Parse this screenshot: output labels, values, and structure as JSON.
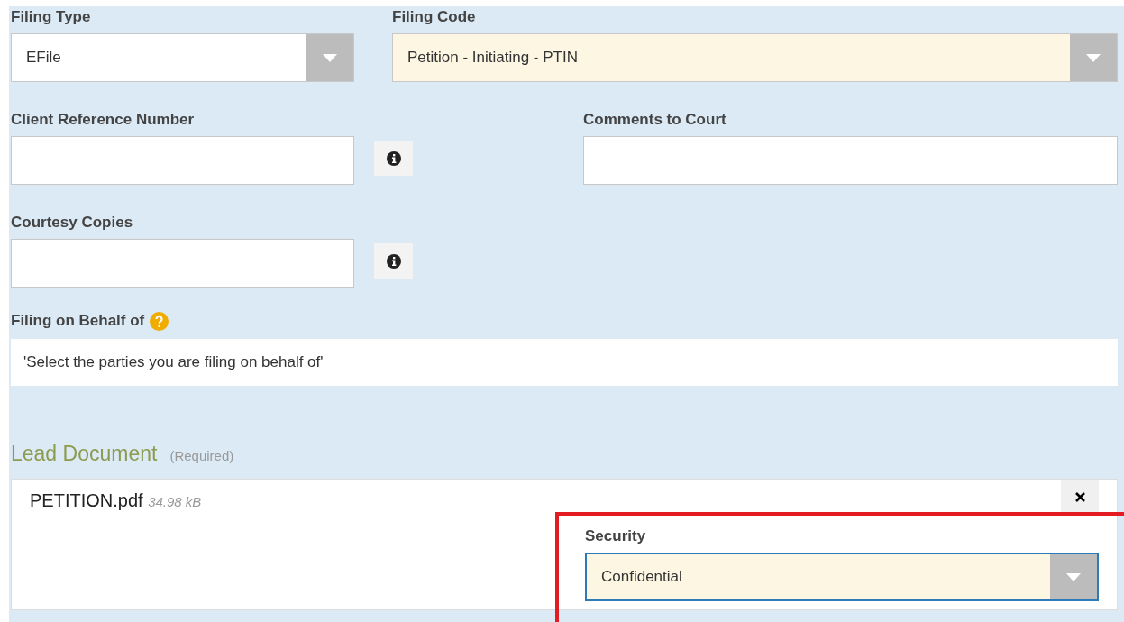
{
  "filing_type": {
    "label": "Filing Type",
    "value": "EFile",
    "highlighted": false
  },
  "filing_code": {
    "label": "Filing Code",
    "value": "Petition - Initiating - PTIN",
    "highlighted": true
  },
  "client_reference_number": {
    "label": "Client Reference Number"
  },
  "comments_to_court": {
    "label": "Comments to Court"
  },
  "courtesy_copies": {
    "label": "Courtesy Copies"
  },
  "filing_on_behalf_of": {
    "label": "Filing on Behalf of",
    "prompt": "'Select the parties you are filing on behalf of'"
  },
  "lead_document": {
    "title": "Lead Document",
    "note": "(Required)",
    "file_name": "PETITION.pdf",
    "file_size": "34.98 kB",
    "security": {
      "label": "Security",
      "value": "Confidential",
      "highlighted": true,
      "focused": true
    },
    "annotated": true
  }
}
